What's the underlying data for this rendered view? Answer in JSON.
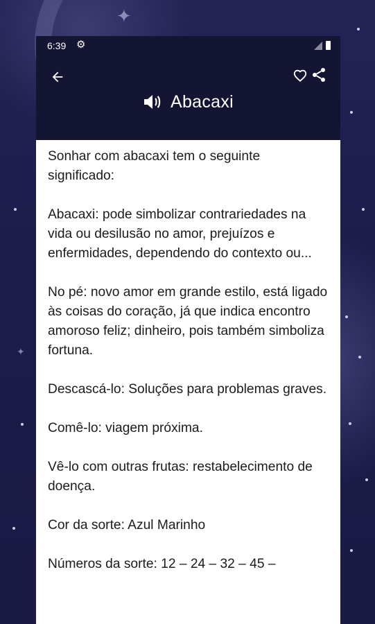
{
  "status_bar": {
    "time": "6:39",
    "settings_icon": "gear-icon",
    "signal_icon": "signal-icon",
    "battery_icon": "battery-icon"
  },
  "toolbar": {
    "back_icon": "arrow-back-icon",
    "favorite_icon": "heart-outline-icon",
    "share_icon": "share-icon",
    "speaker_icon": "speaker-icon",
    "title": "Abacaxi"
  },
  "content": {
    "paragraphs": [
      "Sonhar com abacaxi tem o seguinte significado:",
      "Abacaxi: pode simbolizar contrariedades na vida ou desilusão no amor, prejuízos e enfermidades, dependendo do contexto ou...",
      "No pé: novo amor em grande estilo, está ligado às coisas do coração, já que indica encontro amoroso feliz; dinheiro, pois também simboliza fortuna.",
      "Descascá-lo: Soluções para problemas graves.",
      "Comê-lo: viagem próxima.",
      "Vê-lo com outras frutas: restabelecimento de doença.",
      "Cor da sorte: Azul Marinho",
      "Números da sorte: 12 – 24 – 32 – 45 –"
    ]
  },
  "colors": {
    "background": "#1b1b46",
    "app_bar": "#141433",
    "card": "#ffffff",
    "text": "#1b1b1b"
  }
}
